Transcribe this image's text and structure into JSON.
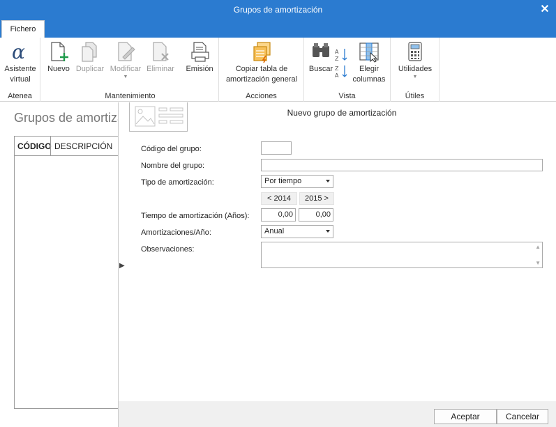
{
  "window": {
    "title": "Grupos de amortización"
  },
  "tabs": [
    {
      "label": "Fichero"
    }
  ],
  "ribbon": {
    "groups": {
      "atenea": "Atenea",
      "mantenimiento": "Mantenimiento",
      "acciones": "Acciones",
      "vista": "Vista",
      "utiles": "Útiles"
    },
    "buttons": {
      "asistente_1": "Asistente",
      "asistente_2": "virtual",
      "nuevo": "Nuevo",
      "duplicar": "Duplicar",
      "modificar": "Modificar",
      "eliminar": "Eliminar",
      "emision": "Emisión",
      "copiar_1": "Copiar tabla de",
      "copiar_2": "amortización general",
      "buscar": "Buscar",
      "elegir_1": "Elegir",
      "elegir_2": "columnas",
      "utilidades": "Utilidades"
    }
  },
  "left_pane": {
    "title": "Grupos de amortización",
    "columns": [
      "CÓDIGO",
      "DESCRIPCIÓN"
    ]
  },
  "dialog": {
    "title": "Nuevo grupo de amortización",
    "fields": {
      "codigo_label": "Código del grupo:",
      "codigo_value": "",
      "nombre_label": "Nombre del grupo:",
      "nombre_value": "",
      "tipo_label": "Tipo de amortización:",
      "tipo_value": "Por tiempo",
      "prev_year": "< 2014",
      "next_year": "2015 >",
      "tiempo_label": "Tiempo de amortización (Años):",
      "tiempo_value_1": "0,00",
      "tiempo_value_2": "0,00",
      "amort_label": "Amortizaciones/Año:",
      "amort_value": "Anual",
      "obs_label": "Observaciones:",
      "obs_value": ""
    },
    "buttons": {
      "accept": "Aceptar",
      "cancel": "Cancelar"
    }
  },
  "colors": {
    "titlebar": "#2b7bd0",
    "accent_green": "#1f9a4a",
    "accent_orange": "#f0a020"
  }
}
